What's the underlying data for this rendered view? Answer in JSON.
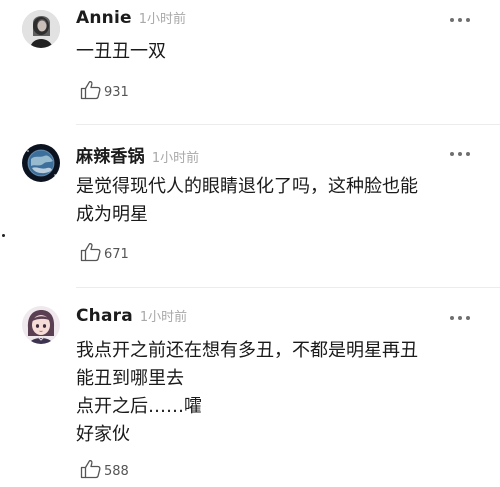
{
  "comments": [
    {
      "username": "Annie",
      "timestamp": "1小时前",
      "lines": [
        "一丑丑一双"
      ],
      "likes": "931",
      "avatar_icon": "user-avatar"
    },
    {
      "username": "麻辣香锅",
      "timestamp": "1小时前",
      "lines": [
        "是觉得现代人的眼睛退化了吗，这种脸也能",
        "成为明星"
      ],
      "likes": "671",
      "avatar_icon": "planet-avatar"
    },
    {
      "username": "Chara",
      "timestamp": "1小时前",
      "lines": [
        "我点开之前还在想有多丑，不都是明星再丑",
        "能丑到哪里去",
        "点开之后……嚯",
        "好家伙"
      ],
      "likes": "588",
      "avatar_icon": "anime-avatar"
    }
  ],
  "icons": {
    "more": "more-dots-icon",
    "like": "thumbs-up-icon"
  }
}
